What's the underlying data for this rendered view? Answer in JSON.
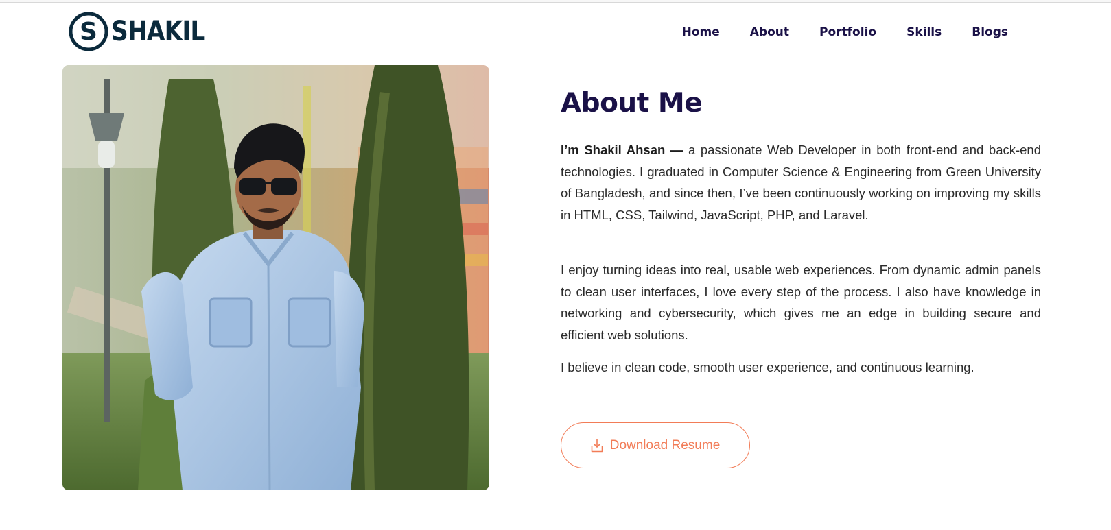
{
  "brand": {
    "logo_text": "SHAKIL",
    "logo_letter": "S"
  },
  "nav": {
    "items": [
      {
        "label": "Home"
      },
      {
        "label": "About"
      },
      {
        "label": "Portfolio"
      },
      {
        "label": "Skills"
      },
      {
        "label": "Blogs"
      }
    ]
  },
  "about": {
    "title": "About Me",
    "intro_name": "I’m Shakil Ahsan —",
    "p1_rest": " a passionate Web Developer in both front-end and back-end technologies. I graduated in Computer Science & Engineering from Green University of Bangladesh, and since then, I’ve been continuously working on improving my skills in HTML, CSS, Tailwind, JavaScript, PHP, and Laravel.",
    "p2": "I enjoy turning ideas into real, usable web experiences. From dynamic admin panels to clean user interfaces, I love every step of the process. I also have knowledge in networking and cybersecurity, which gives me an edge in building secure and efficient web solutions.",
    "p3": "I believe in clean code, smooth user experience, and continuous learning.",
    "download_label": "Download Resume",
    "download_icon": "download-icon"
  },
  "colors": {
    "heading": "#1a1147",
    "logo": "#0b2a3c",
    "accent": "#f27c57"
  }
}
